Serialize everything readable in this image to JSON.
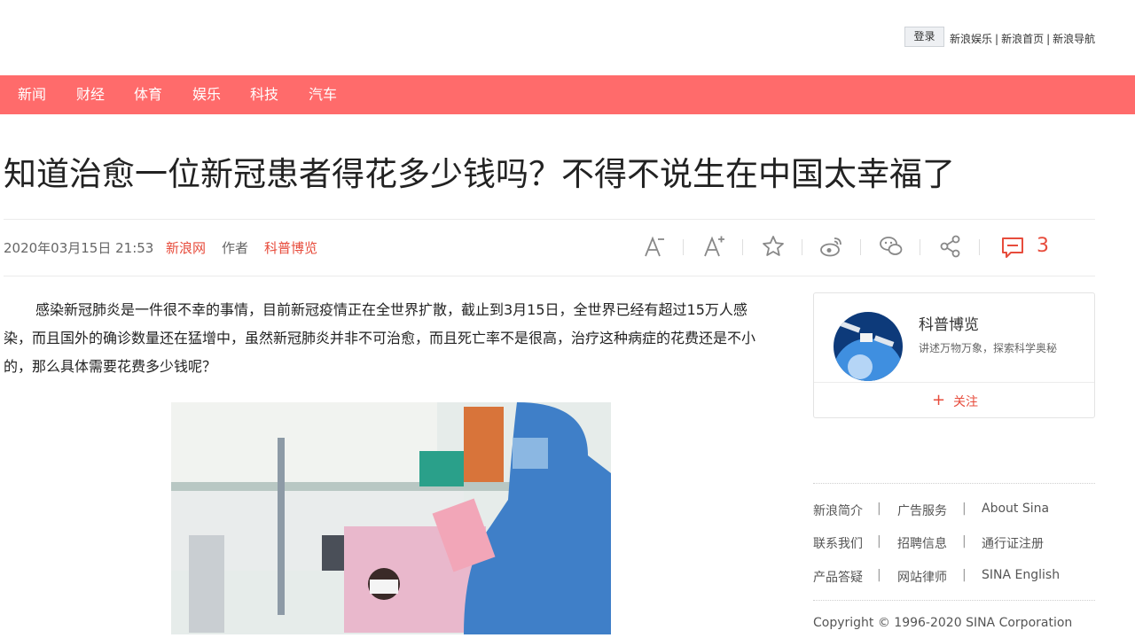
{
  "topbar": {
    "login_label": "登录",
    "links": [
      "新浪娱乐",
      "新浪首页",
      "新浪导航"
    ]
  },
  "nav": {
    "items": [
      "新闻",
      "财经",
      "体育",
      "娱乐",
      "科技",
      "汽车"
    ],
    "bg_color": "#ff6b6b"
  },
  "article": {
    "title": "知道治愈一位新冠患者得花多少钱吗？不得不说生在中国太幸福了",
    "date": "2020年03月15日 21:53",
    "source": "新浪网",
    "author_label": "作者",
    "author": "科普博览",
    "comment_count": "3",
    "paragraph": "感染新冠肺炎是一件很不幸的事情，目前新冠疫情正在全世界扩散，截止到3月15日，全世界已经有超过15万人感染，而且国外的确诊数量还在猛增中，虽然新冠肺炎并非不可治愈，而且死亡率不是很高，治疗这种病症的花费还是不小的，那么具体需要花费多少钱呢？"
  },
  "toolbar": {
    "icons": [
      "font-decrease-icon",
      "font-increase-icon",
      "star-icon",
      "weibo-icon",
      "wechat-icon",
      "share-icon",
      "comment-icon"
    ]
  },
  "sidebar": {
    "name": "科普博览",
    "desc": "讲述万物万象，探索科学奥秘",
    "follow_label": "关注",
    "footer_links": [
      [
        "新浪简介",
        "广告服务",
        "About Sina"
      ],
      [
        "联系我们",
        "招聘信息",
        "通行证注册"
      ],
      [
        "产品答疑",
        "网站律师",
        "SINA English"
      ]
    ],
    "copyright": "Copyright © 1996-2020 SINA Corporation"
  },
  "colors": {
    "accent": "#e74c3c"
  }
}
